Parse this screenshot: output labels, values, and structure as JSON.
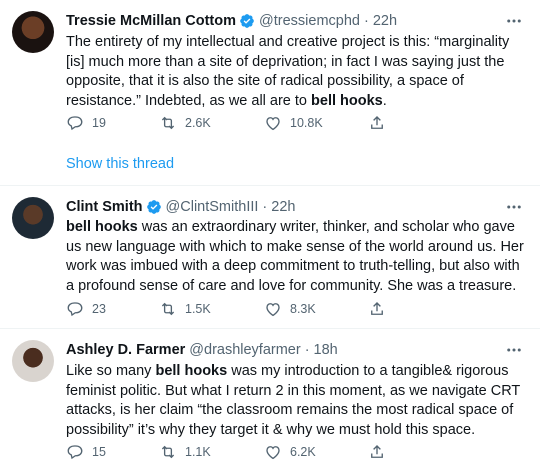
{
  "tweets": [
    {
      "name": "Tressie McMillan Cottom",
      "handle": "@tressiemcphd",
      "time": "22h",
      "text_before": "The entirety of my intellectual and creative project is this: “marginality [is] much more than a site of deprivation; in fact I was saying just the opposite, that it is also the site of radical possibility, a space of resistance.” Indebted, as we all are to ",
      "text_bold": "bell hooks",
      "text_after": ".",
      "replies": "19",
      "retweets": "2.6K",
      "likes": "10.8K",
      "show_thread": "Show this thread"
    },
    {
      "name": "Clint Smith",
      "handle": "@ClintSmithIII",
      "time": "22h",
      "text_before": "",
      "text_bold": "bell hooks",
      "text_after": " was an extraordinary writer, thinker, and scholar who gave us new language with which to make sense of the world around us. Her work was imbued with a deep commitment to truth-telling, but also with a profound sense of care and love for community. She was a treasure.",
      "replies": "23",
      "retweets": "1.5K",
      "likes": "8.3K"
    },
    {
      "name": "Ashley D. Farmer",
      "handle": "@drashleyfarmer",
      "time": "18h",
      "text_before": "Like so many ",
      "text_bold": "bell hooks",
      "text_after": " was my introduction to a tangible& rigorous feminist politic. But what I return 2 in this moment, as we navigate CRT attacks, is her claim “the classroom remains the most radical space of possibility” it’s why they target it & why we must hold this space.",
      "replies": "15",
      "retweets": "1.1K",
      "likes": "6.2K"
    }
  ],
  "separator": "·",
  "colors": {
    "text": "#0f1419",
    "secondary": "#536471",
    "link": "#1d9bf0",
    "verified": "#1d9bf0",
    "border": "#eff3f4"
  },
  "icons": [
    "verified-badge-icon",
    "more-icon",
    "reply-icon",
    "retweet-icon",
    "like-icon",
    "share-icon"
  ]
}
